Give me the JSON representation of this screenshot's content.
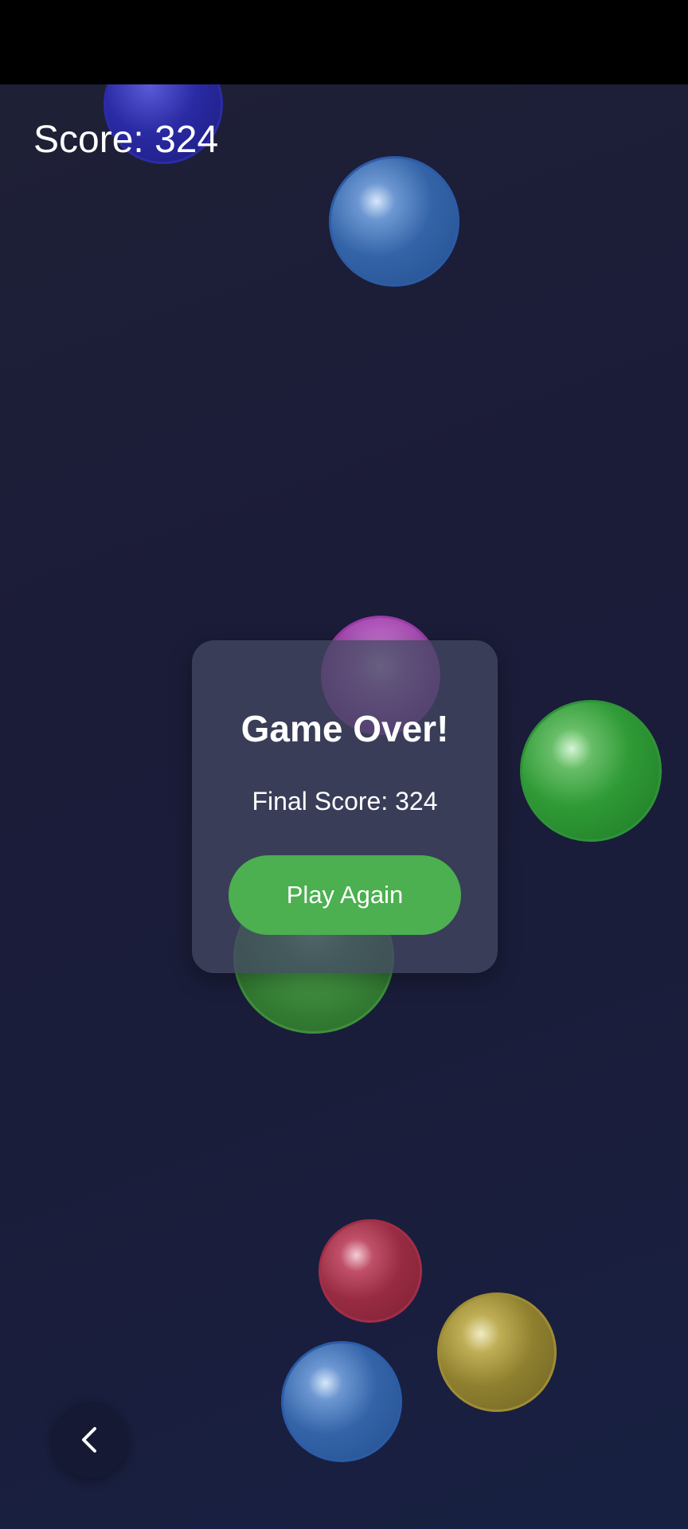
{
  "hud": {
    "score_text": "Score: 324"
  },
  "game_over_dialog": {
    "title": "Game Over!",
    "final_score_text": "Final Score: 324",
    "play_again_label": "Play Again"
  },
  "navigation": {
    "back_icon": "chevron-left-icon"
  },
  "bubbles": [
    {
      "color": "indigo"
    },
    {
      "color": "blue"
    },
    {
      "color": "magenta"
    },
    {
      "color": "green"
    },
    {
      "color": "green"
    },
    {
      "color": "red"
    },
    {
      "color": "gold"
    },
    {
      "color": "blue"
    }
  ],
  "colors": {
    "background": "#1b1d38",
    "button_green": "#4caf50",
    "dialog_bg": "#424662",
    "text": "#ffffff"
  }
}
